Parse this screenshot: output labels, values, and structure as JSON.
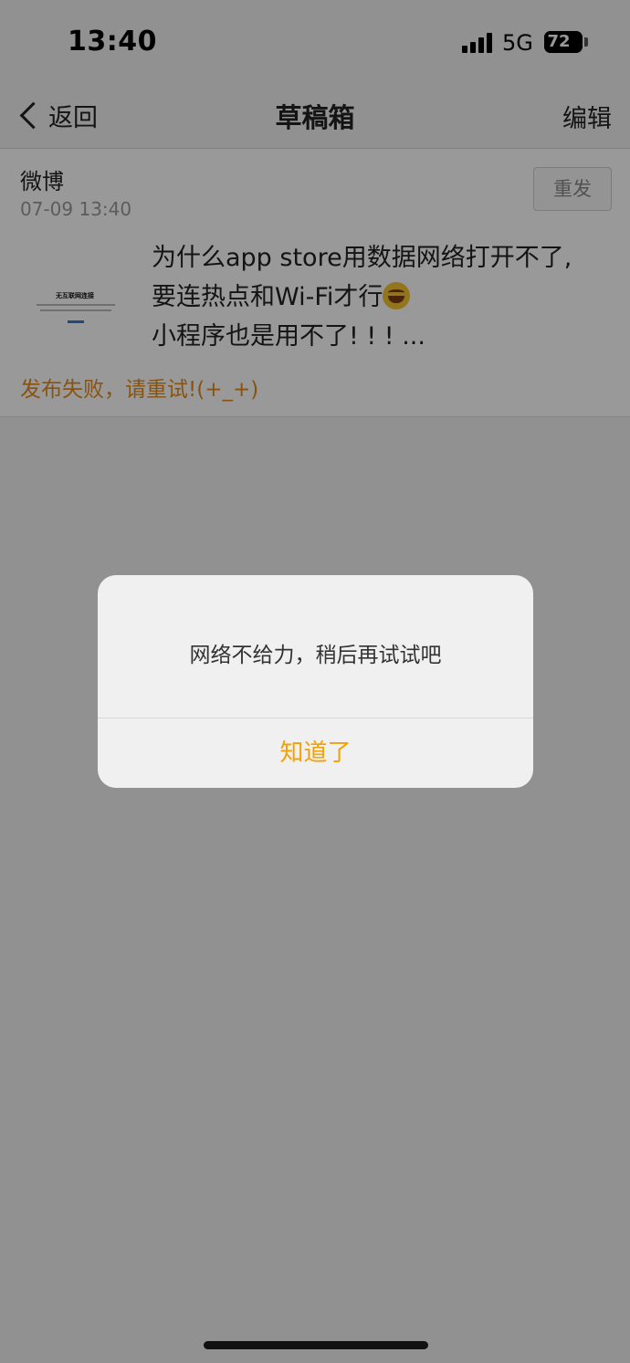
{
  "status_bar": {
    "time": "13:40",
    "network": "5G",
    "battery_level": "72"
  },
  "nav": {
    "back_label": "返回",
    "title": "草稿箱",
    "edit_label": "编辑"
  },
  "draft": {
    "source": "微博",
    "time": "07-09 13:40",
    "resend_label": "重发",
    "thumbnail_title": "无互联网连接",
    "text_lines": [
      "为什么app store用数据网络打开不了,",
      "要连热点和Wi-Fi才行",
      "小程序也是用不了! ! !  ..."
    ],
    "emoji": "face-with-tears-of-joy-icon",
    "error_text": "发布失败，请重试!(+_+)"
  },
  "alert": {
    "message": "网络不给力，稍后再试试吧",
    "button_label": "知道了"
  },
  "colors": {
    "accent_orange": "#f5a000",
    "error_orange": "#e48a1a"
  }
}
